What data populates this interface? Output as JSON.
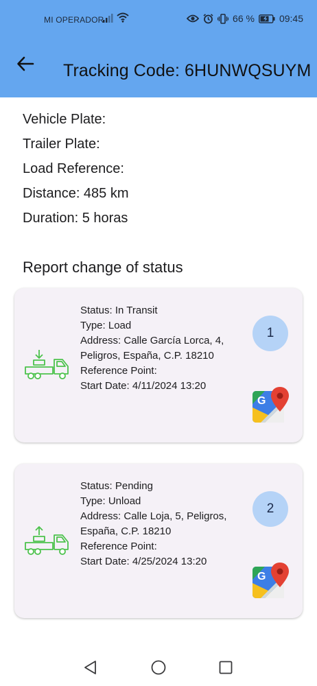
{
  "status_bar": {
    "carrier": "MI OPERADOR",
    "battery_percent": "66 %",
    "time": "09:45"
  },
  "header": {
    "back_icon": "arrow-left-icon",
    "title": "Tracking Code: 6HUNWQSUYM"
  },
  "shipment": {
    "vehicle_plate": "Vehicle Plate:",
    "trailer_plate": "Trailer Plate:",
    "load_reference": "Load Reference:",
    "distance": "Distance: 485 km",
    "duration": "Duration: 5 horas"
  },
  "section_title": "Report change of status",
  "stops": [
    {
      "number": "1",
      "icon": "truck-load-icon",
      "status": "Status: In Transit",
      "type": "Type: Load",
      "address": "Address: Calle García Lorca, 4, Peligros, España, C.P. 18210",
      "reference_point": "Reference Point:",
      "start_date": "Start Date: 4/11/2024 13:20"
    },
    {
      "number": "2",
      "icon": "truck-unload-icon",
      "status": "Status: Pending",
      "type": "Type: Unload",
      "address": "Address: Calle Loja, 5, Peligros, España, C.P. 18210",
      "reference_point": "Reference Point:",
      "start_date": "Start Date: 4/25/2024 13:20"
    }
  ],
  "colors": {
    "app_bar": "#64a6ef",
    "card_bg": "#f5f1f7",
    "badge_bg": "#b5d3f7",
    "truck_icon": "#4cc24c"
  },
  "nav_bar": {
    "back": "triangle-back-icon",
    "home": "circle-home-icon",
    "recent": "square-recent-icon"
  }
}
